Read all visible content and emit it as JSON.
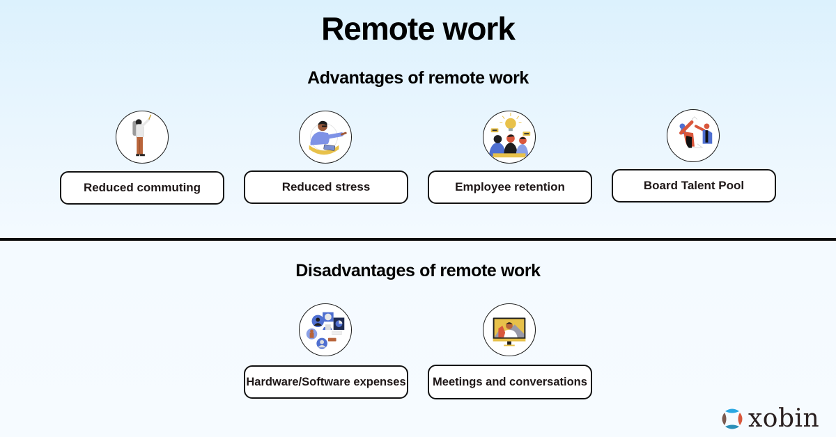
{
  "title": "Remote work",
  "advantages": {
    "heading": "Advantages of remote work",
    "items": [
      {
        "label": "Reduced commuting",
        "icon": "commuter-illustration-icon"
      },
      {
        "label": "Reduced stress",
        "icon": "relaxed-worker-illustration-icon"
      },
      {
        "label": "Employee retention",
        "icon": "team-idea-illustration-icon"
      },
      {
        "label": "Board Talent Pool",
        "icon": "high-five-illustration-icon"
      }
    ]
  },
  "disadvantages": {
    "heading": "Disadvantages of remote work",
    "items": [
      {
        "label": "Hardware/Software expenses",
        "icon": "devices-network-illustration-icon"
      },
      {
        "label": "Meetings and conversations",
        "icon": "video-call-monitor-illustration-icon"
      }
    ]
  },
  "brand": {
    "name": "xobin",
    "colors": {
      "blue": "#2aa7e2",
      "red": "#d9573c",
      "brown": "#7a5a50",
      "teal": "#2b8fb8"
    }
  },
  "colors": {
    "background_top": "#dcf1fd",
    "background_bottom": "#f6fbff",
    "text": "#000000",
    "pill_border": "#111111",
    "divider": "#0a0a0a"
  }
}
